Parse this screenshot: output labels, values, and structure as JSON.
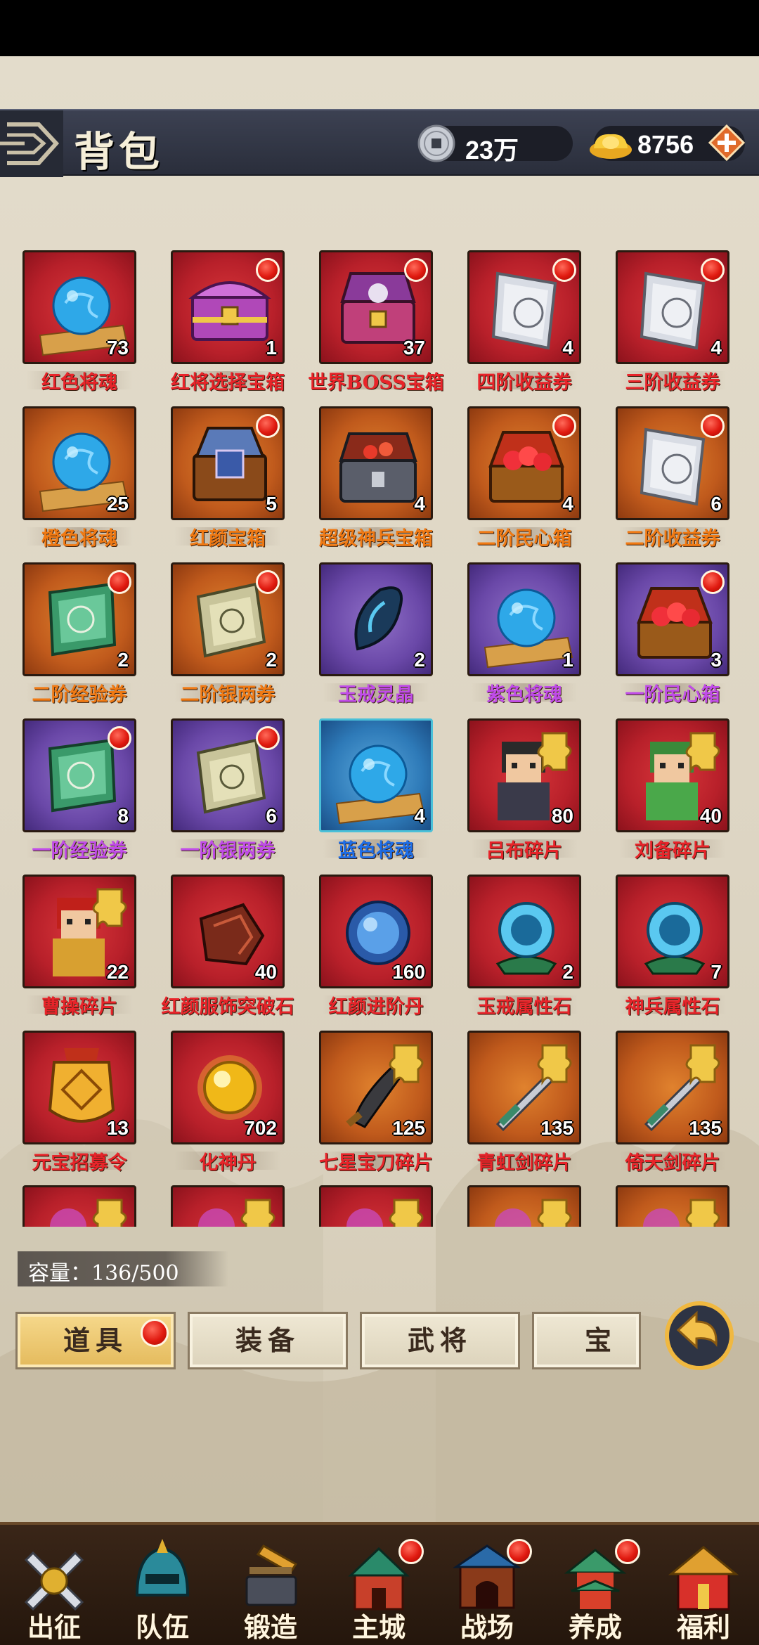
{
  "header": {
    "title": "背包",
    "copper": "23万",
    "gold": "8756"
  },
  "items": [
    {
      "name": "红色将魂",
      "qty": "73",
      "tile": "red",
      "label": "red",
      "icon": "blue-soul-orb-icon",
      "badge": false
    },
    {
      "name": "红将选择宝箱",
      "qty": "1",
      "tile": "red",
      "label": "red",
      "icon": "purple-chest-icon",
      "badge": true
    },
    {
      "name": "世界BOSS宝箱",
      "qty": "37",
      "tile": "red",
      "label": "red",
      "icon": "boss-chest-icon",
      "badge": true
    },
    {
      "name": "四阶收益券",
      "qty": "4",
      "tile": "red",
      "label": "red",
      "icon": "income-ticket-icon",
      "badge": true
    },
    {
      "name": "三阶收益券",
      "qty": "4",
      "tile": "red",
      "label": "red",
      "icon": "income-ticket-icon",
      "badge": true
    },
    {
      "name": "橙色将魂",
      "qty": "25",
      "tile": "orange",
      "label": "orange",
      "icon": "blue-soul-orb-icon",
      "badge": false
    },
    {
      "name": "红颜宝箱",
      "qty": "5",
      "tile": "orange",
      "label": "orange",
      "icon": "beauty-chest-icon",
      "badge": true
    },
    {
      "name": "超级神兵宝箱",
      "qty": "4",
      "tile": "orange",
      "label": "orange",
      "icon": "weapon-chest-icon",
      "badge": false
    },
    {
      "name": "二阶民心箱",
      "qty": "4",
      "tile": "orange",
      "label": "orange",
      "icon": "heart-chest-icon",
      "badge": true
    },
    {
      "name": "二阶收益券",
      "qty": "6",
      "tile": "orange",
      "label": "orange",
      "icon": "income-ticket-icon",
      "badge": true
    },
    {
      "name": "二阶经验券",
      "qty": "2",
      "tile": "orange",
      "label": "orange",
      "icon": "exp-ticket-icon",
      "badge": true
    },
    {
      "name": "二阶银两券",
      "qty": "2",
      "tile": "orange",
      "label": "orange",
      "icon": "silver-ticket-icon",
      "badge": true
    },
    {
      "name": "玉戒灵晶",
      "qty": "2",
      "tile": "purple",
      "label": "purple",
      "icon": "spirit-crystal-icon",
      "badge": false
    },
    {
      "name": "紫色将魂",
      "qty": "1",
      "tile": "purple",
      "label": "purple",
      "icon": "blue-soul-orb-icon",
      "badge": false
    },
    {
      "name": "一阶民心箱",
      "qty": "3",
      "tile": "purple",
      "label": "purple",
      "icon": "heart-chest-icon",
      "badge": true
    },
    {
      "name": "一阶经验券",
      "qty": "8",
      "tile": "purple",
      "label": "purple",
      "icon": "exp-ticket-icon",
      "badge": true
    },
    {
      "name": "一阶银两券",
      "qty": "6",
      "tile": "purple",
      "label": "purple",
      "icon": "silver-ticket-icon",
      "badge": true
    },
    {
      "name": "蓝色将魂",
      "qty": "4",
      "tile": "blue",
      "label": "blue",
      "icon": "blue-soul-orb-icon",
      "badge": false
    },
    {
      "name": "吕布碎片",
      "qty": "80",
      "tile": "red",
      "label": "red",
      "icon": "lubu-fragment-icon",
      "badge": false
    },
    {
      "name": "刘备碎片",
      "qty": "40",
      "tile": "red",
      "label": "red",
      "icon": "liubei-fragment-icon",
      "badge": false
    },
    {
      "name": "曹操碎片",
      "qty": "22",
      "tile": "red",
      "label": "red",
      "icon": "caocao-fragment-icon",
      "badge": false
    },
    {
      "name": "红颜服饰突破石",
      "qty": "40",
      "tile": "red",
      "label": "red",
      "icon": "breakthrough-stone-icon",
      "badge": false
    },
    {
      "name": "红颜进阶丹",
      "qty": "160",
      "tile": "red",
      "label": "red",
      "icon": "advance-pill-icon",
      "badge": false
    },
    {
      "name": "玉戒属性石",
      "qty": "2",
      "tile": "red",
      "label": "red",
      "icon": "ring-attr-stone-icon",
      "badge": false
    },
    {
      "name": "神兵属性石",
      "qty": "7",
      "tile": "red",
      "label": "red",
      "icon": "weapon-attr-stone-icon",
      "badge": false
    },
    {
      "name": "元宝招募令",
      "qty": "13",
      "tile": "red",
      "label": "red",
      "icon": "recruit-token-icon",
      "badge": false
    },
    {
      "name": "化神丹",
      "qty": "702",
      "tile": "red",
      "label": "red",
      "icon": "golden-pill-icon",
      "badge": false
    },
    {
      "name": "七星宝刀碎片",
      "qty": "125",
      "tile": "orange",
      "label": "red",
      "icon": "blade-fragment-icon",
      "badge": false
    },
    {
      "name": "青虹剑碎片",
      "qty": "135",
      "tile": "orange",
      "label": "red",
      "icon": "sword-fragment-icon",
      "badge": false
    },
    {
      "name": "倚天剑碎片",
      "qty": "135",
      "tile": "orange",
      "label": "red",
      "icon": "sword-fragment-icon",
      "badge": false
    }
  ],
  "partial_row": [
    "red",
    "red",
    "red",
    "orange",
    "orange"
  ],
  "capacity": "容量：136/500",
  "tabs": [
    {
      "label": "道具",
      "active": true,
      "badge": true
    },
    {
      "label": "装备",
      "active": false,
      "badge": false
    },
    {
      "label": "武将",
      "active": false,
      "badge": false
    },
    {
      "label": "宝物",
      "active": false,
      "badge": false
    }
  ],
  "nav": [
    {
      "label": "出征",
      "icon": "crossed-swords-icon",
      "badge": false
    },
    {
      "label": "队伍",
      "icon": "helmet-icon",
      "badge": false
    },
    {
      "label": "锻造",
      "icon": "anvil-hammer-icon",
      "badge": false
    },
    {
      "label": "主城",
      "icon": "castle-icon",
      "badge": true
    },
    {
      "label": "战场",
      "icon": "battle-gate-icon",
      "badge": true
    },
    {
      "label": "养成",
      "icon": "pagoda-icon",
      "badge": true
    },
    {
      "label": "福利",
      "icon": "gift-palace-icon",
      "badge": false
    }
  ],
  "colors": {
    "header_bg": "#2e3240",
    "label_red": "#e8242a",
    "label_orange": "#f07a14",
    "label_purple": "#c04ce8",
    "label_blue": "#1e6ee8",
    "tab_active": "#e4ba5c"
  }
}
